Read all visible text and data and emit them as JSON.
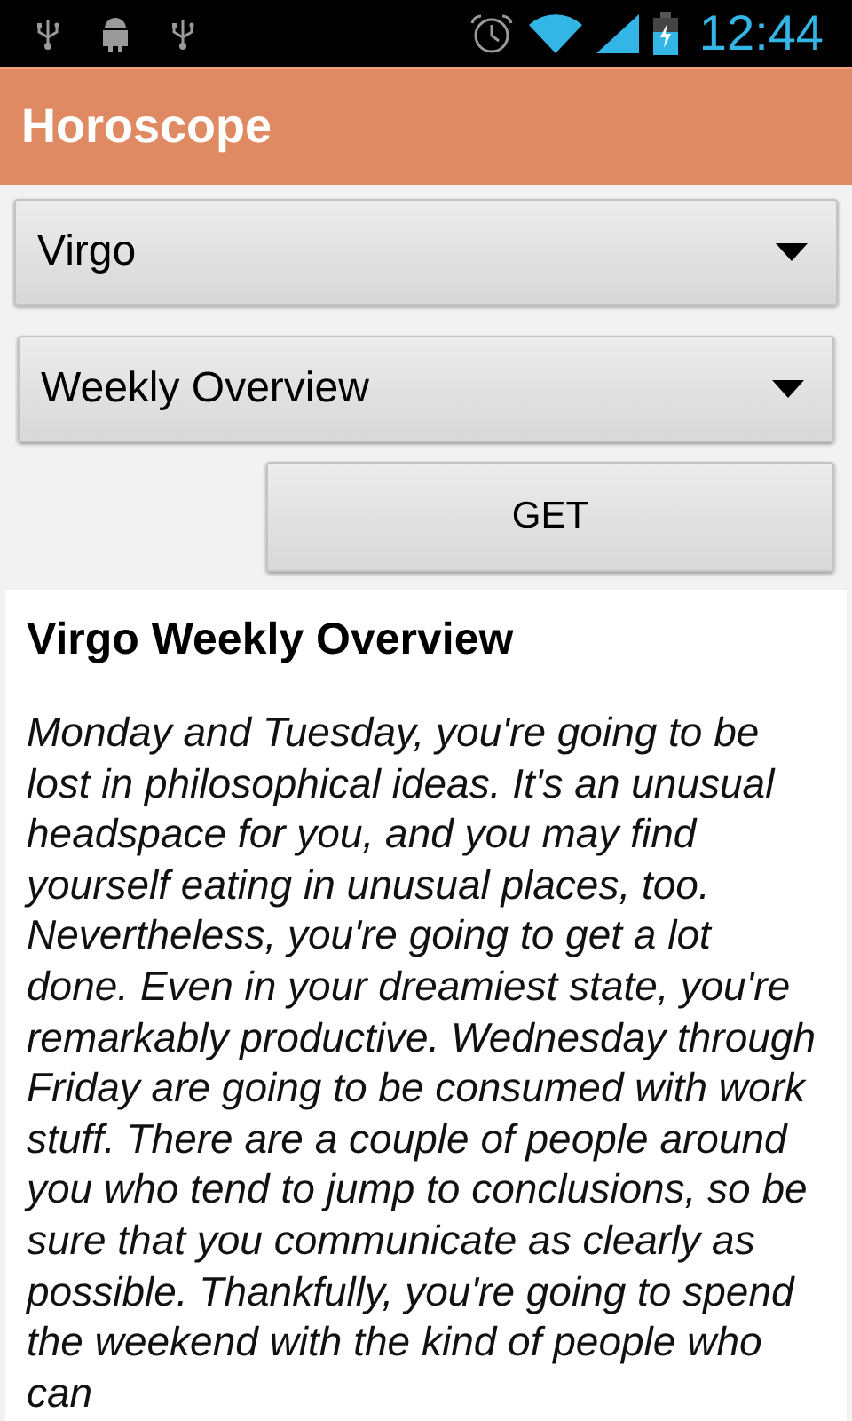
{
  "status_bar": {
    "time": "12:44"
  },
  "app_bar": {
    "title": "Horoscope"
  },
  "sign_dropdown": {
    "value": "Virgo"
  },
  "period_dropdown": {
    "value": "Weekly Overview"
  },
  "get_button": {
    "label": "GET"
  },
  "result": {
    "heading": "Virgo Weekly Overview",
    "body": "Monday and Tuesday, you're going to be lost in philosophical ideas. It's an unusual headspace for you, and you may find yourself eating in unusual places, too. Nevertheless, you're going to get a lot done. Even in your dreamiest state, you're remarkably productive. Wednesday through Friday are going to be consumed with work stuff. There are a couple of people around you who tend to jump to conclusions, so be sure that you communicate as clearly as possible. Thankfully, you're going to spend the weekend with the kind of people who can"
  }
}
